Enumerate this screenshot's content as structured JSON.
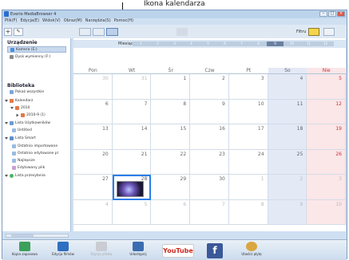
{
  "callout": {
    "label": "Ikona kalendarza"
  },
  "window": {
    "title": "Everio MediaBrowser 4",
    "controls": {
      "minimize": "–",
      "maximize": "□",
      "close": "×"
    }
  },
  "menu": [
    "Plik(F)",
    "Edycja(E)",
    "Widok(V)",
    "Obraz(M)",
    "Narzędzia(S)",
    "Pomoc(H)"
  ],
  "toolbar": {
    "add": "+",
    "edit": "✎",
    "filter_label": "Filtru"
  },
  "sidebar": {
    "device_heading": "Urządzenie",
    "devices": [
      "Kamera (E:)",
      "Dysk wymienny (F:)"
    ],
    "library_heading": "Biblioteka",
    "library": [
      {
        "label": "Pokaż wszystkie"
      },
      {
        "label": "Kalendarz"
      },
      {
        "label": "2010"
      },
      {
        "label": "2010-9 (1)"
      },
      {
        "label": "Lista Użytkowników"
      },
      {
        "label": "Untitled"
      },
      {
        "label": "Lista Smart"
      },
      {
        "label": "Ostatnio importowane"
      },
      {
        "label": "Ostatnio edytowane pl"
      },
      {
        "label": "Najlepsze"
      },
      {
        "label": "Edytowany plik"
      },
      {
        "label": "Lista przesyłania"
      }
    ]
  },
  "calendar": {
    "month_label": "Miesiąc",
    "months": [
      "1",
      "2",
      "3",
      "4",
      "5",
      "6",
      "7",
      "8",
      "9",
      "10",
      "11",
      "12"
    ],
    "current_month": "9",
    "weekdays": [
      "Pon",
      "Wt",
      "Śr",
      "Czw",
      "Pt",
      "So",
      "Nie"
    ],
    "weeks": [
      [
        "30",
        "31",
        "1",
        "2",
        "3",
        "4",
        "5"
      ],
      [
        "6",
        "7",
        "8",
        "9",
        "10",
        "11",
        "12"
      ],
      [
        "13",
        "14",
        "15",
        "16",
        "17",
        "18",
        "19"
      ],
      [
        "20",
        "21",
        "22",
        "23",
        "24",
        "25",
        "26"
      ],
      [
        "27",
        "28",
        "29",
        "30",
        "1",
        "2",
        "3"
      ],
      [
        "4",
        "5",
        "6",
        "7",
        "8",
        "9",
        "10"
      ]
    ]
  },
  "bottom": {
    "buttons": [
      {
        "label": "Kopia zapasowa",
        "color": "#3aa05a"
      },
      {
        "label": "Edycja filmów",
        "color": "#2f6fc0"
      },
      {
        "label": "Edycja plików",
        "color": "#c9ccd2"
      },
      {
        "label": "Udostępnij",
        "color": "#3a6db0"
      },
      {
        "label": "YouTube",
        "color": "#cc2a1e"
      },
      {
        "label": "f",
        "color": "#3b5998"
      },
      {
        "label": "Utwórz płytę",
        "color": "#d9a640"
      }
    ]
  }
}
